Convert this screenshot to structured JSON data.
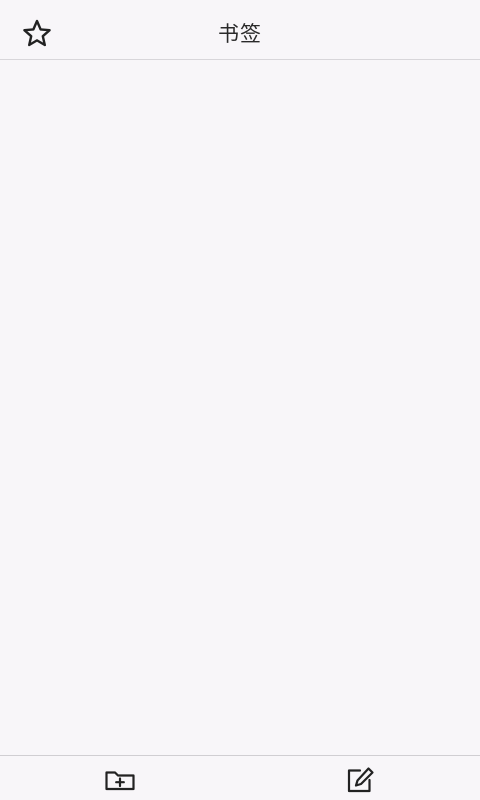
{
  "header": {
    "title": "书签",
    "left_icon": "star-icon"
  },
  "footer": {
    "left_icon": "new-folder-icon",
    "right_icon": "edit-icon"
  },
  "colors": {
    "background": "#f8f6f9",
    "divider": "#d8d6da",
    "icon": "#222222",
    "title": "#2a2a2a"
  }
}
